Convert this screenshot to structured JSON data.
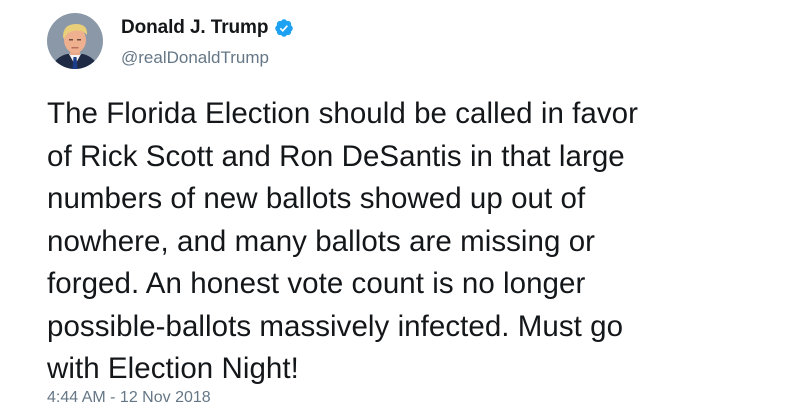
{
  "tweet": {
    "author": {
      "display_name": "Donald J. Trump",
      "handle": "@realDonaldTrump",
      "verified": true,
      "avatar_icon": "profile-photo"
    },
    "text": "The Florida Election should be called in favor\nof Rick Scott and Ron DeSantis in that large\nnumbers of new ballots showed up out of\nnowhere, and many ballots are missing or\nforged. An honest vote count is no longer\npossible-ballots massively infected. Must go\nwith Election Night!",
    "timestamp": "4:44 AM - 12 Nov 2018"
  },
  "colors": {
    "text_primary": "#14171a",
    "text_secondary": "#657786",
    "verified_badge": "#1da1f2",
    "background": "#ffffff"
  }
}
